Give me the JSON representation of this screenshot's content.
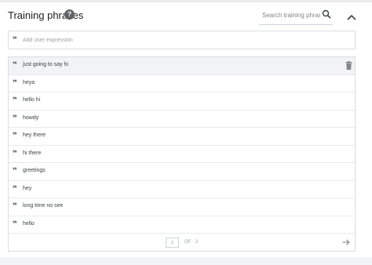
{
  "header": {
    "title": "Training phrases",
    "help_icon": "help-circle-icon",
    "search_placeholder": "Search training phrases",
    "search_icon": "search-icon",
    "collapse_icon": "chevron-up-icon"
  },
  "add_expression": {
    "icon": "quote-icon",
    "placeholder": "Add user expression"
  },
  "phrases": [
    {
      "text": "just going to say hi"
    },
    {
      "text": "heya"
    },
    {
      "text": "hello hi"
    },
    {
      "text": "howdy"
    },
    {
      "text": "hey there"
    },
    {
      "text": "hi there"
    },
    {
      "text": "greetings"
    },
    {
      "text": "hey"
    },
    {
      "text": "long time no see"
    },
    {
      "text": "hello"
    }
  ],
  "row_actions": {
    "delete_icon": "trash-icon"
  },
  "pagination": {
    "current_page": "1",
    "of_label": "OF",
    "total_pages": "2",
    "next_icon": "arrow-right-icon"
  },
  "colors": {
    "text": "#202124",
    "muted": "#5f6368",
    "border": "#dadce0",
    "hover_row": "#f1f3f4"
  }
}
